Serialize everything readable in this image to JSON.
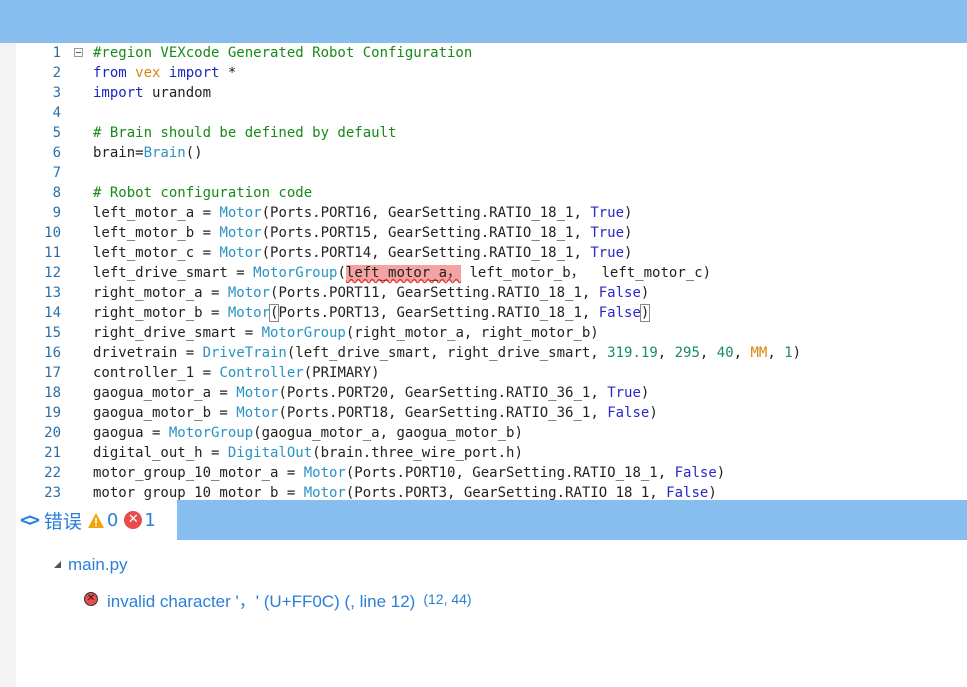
{
  "editor": {
    "fold_marker_line": 1,
    "lines": [
      {
        "n": "1",
        "segments": [
          {
            "t": "#region VEXcode Generated Robot Configuration",
            "c": "cm"
          }
        ]
      },
      {
        "n": "2",
        "segments": [
          {
            "t": "from",
            "c": "kw"
          },
          {
            "t": " "
          },
          {
            "t": "vex",
            "c": "mod"
          },
          {
            "t": " "
          },
          {
            "t": "import",
            "c": "kw"
          },
          {
            "t": " *"
          }
        ]
      },
      {
        "n": "3",
        "segments": [
          {
            "t": "import",
            "c": "kw"
          },
          {
            "t": " urandom"
          }
        ]
      },
      {
        "n": "4",
        "segments": []
      },
      {
        "n": "5",
        "segments": [
          {
            "t": "# Brain should be defined by default",
            "c": "cm"
          }
        ]
      },
      {
        "n": "6",
        "segments": [
          {
            "t": "brain=",
            "c": ""
          },
          {
            "t": "Brain",
            "c": "cls"
          },
          {
            "t": "()"
          }
        ]
      },
      {
        "n": "7",
        "segments": []
      },
      {
        "n": "8",
        "segments": [
          {
            "t": "# Robot configuration code",
            "c": "cm"
          }
        ]
      },
      {
        "n": "9",
        "segments": [
          {
            "t": "left_motor_a = "
          },
          {
            "t": "Motor",
            "c": "cls"
          },
          {
            "t": "(Ports.PORT16, GearSetting.RATIO_18_1, "
          },
          {
            "t": "True",
            "c": "bool"
          },
          {
            "t": ")"
          }
        ]
      },
      {
        "n": "10",
        "segments": [
          {
            "t": "left_motor_b = "
          },
          {
            "t": "Motor",
            "c": "cls"
          },
          {
            "t": "(Ports.PORT15, GearSetting.RATIO_18_1, "
          },
          {
            "t": "True",
            "c": "bool"
          },
          {
            "t": ")"
          }
        ]
      },
      {
        "n": "11",
        "segments": [
          {
            "t": "left_motor_c = "
          },
          {
            "t": "Motor",
            "c": "cls"
          },
          {
            "t": "(Ports.PORT14, GearSetting.RATIO_18_1, "
          },
          {
            "t": "True",
            "c": "bool"
          },
          {
            "t": ")"
          }
        ]
      },
      {
        "n": "12",
        "segments": [
          {
            "t": "left_drive_smart = "
          },
          {
            "t": "MotorGroup",
            "c": "cls"
          },
          {
            "t": "("
          },
          {
            "t": "left_motor_a，",
            "c": "err"
          },
          {
            "t": " left_motor_b，  left_motor_c)"
          }
        ]
      },
      {
        "n": "13",
        "segments": [
          {
            "t": "right_motor_a = "
          },
          {
            "t": "Motor",
            "c": "cls"
          },
          {
            "t": "(Ports.PORT11, GearSetting.RATIO_18_1, "
          },
          {
            "t": "False",
            "c": "bool"
          },
          {
            "t": ")"
          }
        ]
      },
      {
        "n": "14",
        "segments": [
          {
            "t": "right_motor_b = "
          },
          {
            "t": "Motor",
            "c": "cls"
          },
          {
            "t": "(",
            "c": "bm"
          },
          {
            "t": "Ports.PORT13, GearSetting.RATIO_18_1, "
          },
          {
            "t": "False",
            "c": "bool"
          },
          {
            "t": ")",
            "c": "bm"
          }
        ]
      },
      {
        "n": "15",
        "segments": [
          {
            "t": "right_drive_smart = "
          },
          {
            "t": "MotorGroup",
            "c": "cls"
          },
          {
            "t": "(right_motor_a, right_motor_b)"
          }
        ]
      },
      {
        "n": "16",
        "segments": [
          {
            "t": "drivetrain = "
          },
          {
            "t": "DriveTrain",
            "c": "cls"
          },
          {
            "t": "(left_drive_smart, right_drive_smart, "
          },
          {
            "t": "319.19",
            "c": "num"
          },
          {
            "t": ", "
          },
          {
            "t": "295",
            "c": "num"
          },
          {
            "t": ", "
          },
          {
            "t": "40",
            "c": "num"
          },
          {
            "t": ", "
          },
          {
            "t": "MM",
            "c": "const"
          },
          {
            "t": ", "
          },
          {
            "t": "1",
            "c": "num"
          },
          {
            "t": ")"
          }
        ]
      },
      {
        "n": "17",
        "segments": [
          {
            "t": "controller_1 = "
          },
          {
            "t": "Controller",
            "c": "cls"
          },
          {
            "t": "(PRIMARY)"
          }
        ]
      },
      {
        "n": "18",
        "segments": [
          {
            "t": "gaogua_motor_a = "
          },
          {
            "t": "Motor",
            "c": "cls"
          },
          {
            "t": "(Ports.PORT20, GearSetting.RATIO_36_1, "
          },
          {
            "t": "True",
            "c": "bool"
          },
          {
            "t": ")"
          }
        ]
      },
      {
        "n": "19",
        "segments": [
          {
            "t": "gaogua_motor_b = "
          },
          {
            "t": "Motor",
            "c": "cls"
          },
          {
            "t": "(Ports.PORT18, GearSetting.RATIO_36_1, "
          },
          {
            "t": "False",
            "c": "bool"
          },
          {
            "t": ")"
          }
        ]
      },
      {
        "n": "20",
        "segments": [
          {
            "t": "gaogua = "
          },
          {
            "t": "MotorGroup",
            "c": "cls"
          },
          {
            "t": "(gaogua_motor_a, gaogua_motor_b)"
          }
        ]
      },
      {
        "n": "21",
        "segments": [
          {
            "t": "digital_out_h = "
          },
          {
            "t": "DigitalOut",
            "c": "cls"
          },
          {
            "t": "(brain.three_wire_port.h)"
          }
        ]
      },
      {
        "n": "22",
        "segments": [
          {
            "t": "motor_group_10_motor_a = "
          },
          {
            "t": "Motor",
            "c": "cls"
          },
          {
            "t": "(Ports.PORT10, GearSetting.RATIO_18_1, "
          },
          {
            "t": "False",
            "c": "bool"
          },
          {
            "t": ")"
          }
        ]
      },
      {
        "n": "23",
        "segments": [
          {
            "t": "motor_group_10_motor_b = "
          },
          {
            "t": "Motor",
            "c": "cls"
          },
          {
            "t": "(Ports.PORT3, GearSetting.RATIO_18_1, "
          },
          {
            "t": "False",
            "c": "bool"
          },
          {
            "t": ")"
          }
        ]
      }
    ]
  },
  "panel": {
    "chevrons": "<>",
    "title": "错误",
    "warning_count": "0",
    "error_count": "1",
    "icons": {
      "warning": "warning-icon",
      "error": "error-icon",
      "tree": "expand-arrow-icon",
      "error_item": "error-circle-icon"
    },
    "colors": {
      "accent": "#2b7fd8",
      "bar": "#87bdef",
      "error": "#e74c4c",
      "warning": "#f0a30a"
    }
  },
  "problems": {
    "file": "main.py",
    "items": [
      {
        "message": "invalid character '，' (U+FF0C) (, line 12)",
        "position": "(12, 44)"
      }
    ]
  }
}
